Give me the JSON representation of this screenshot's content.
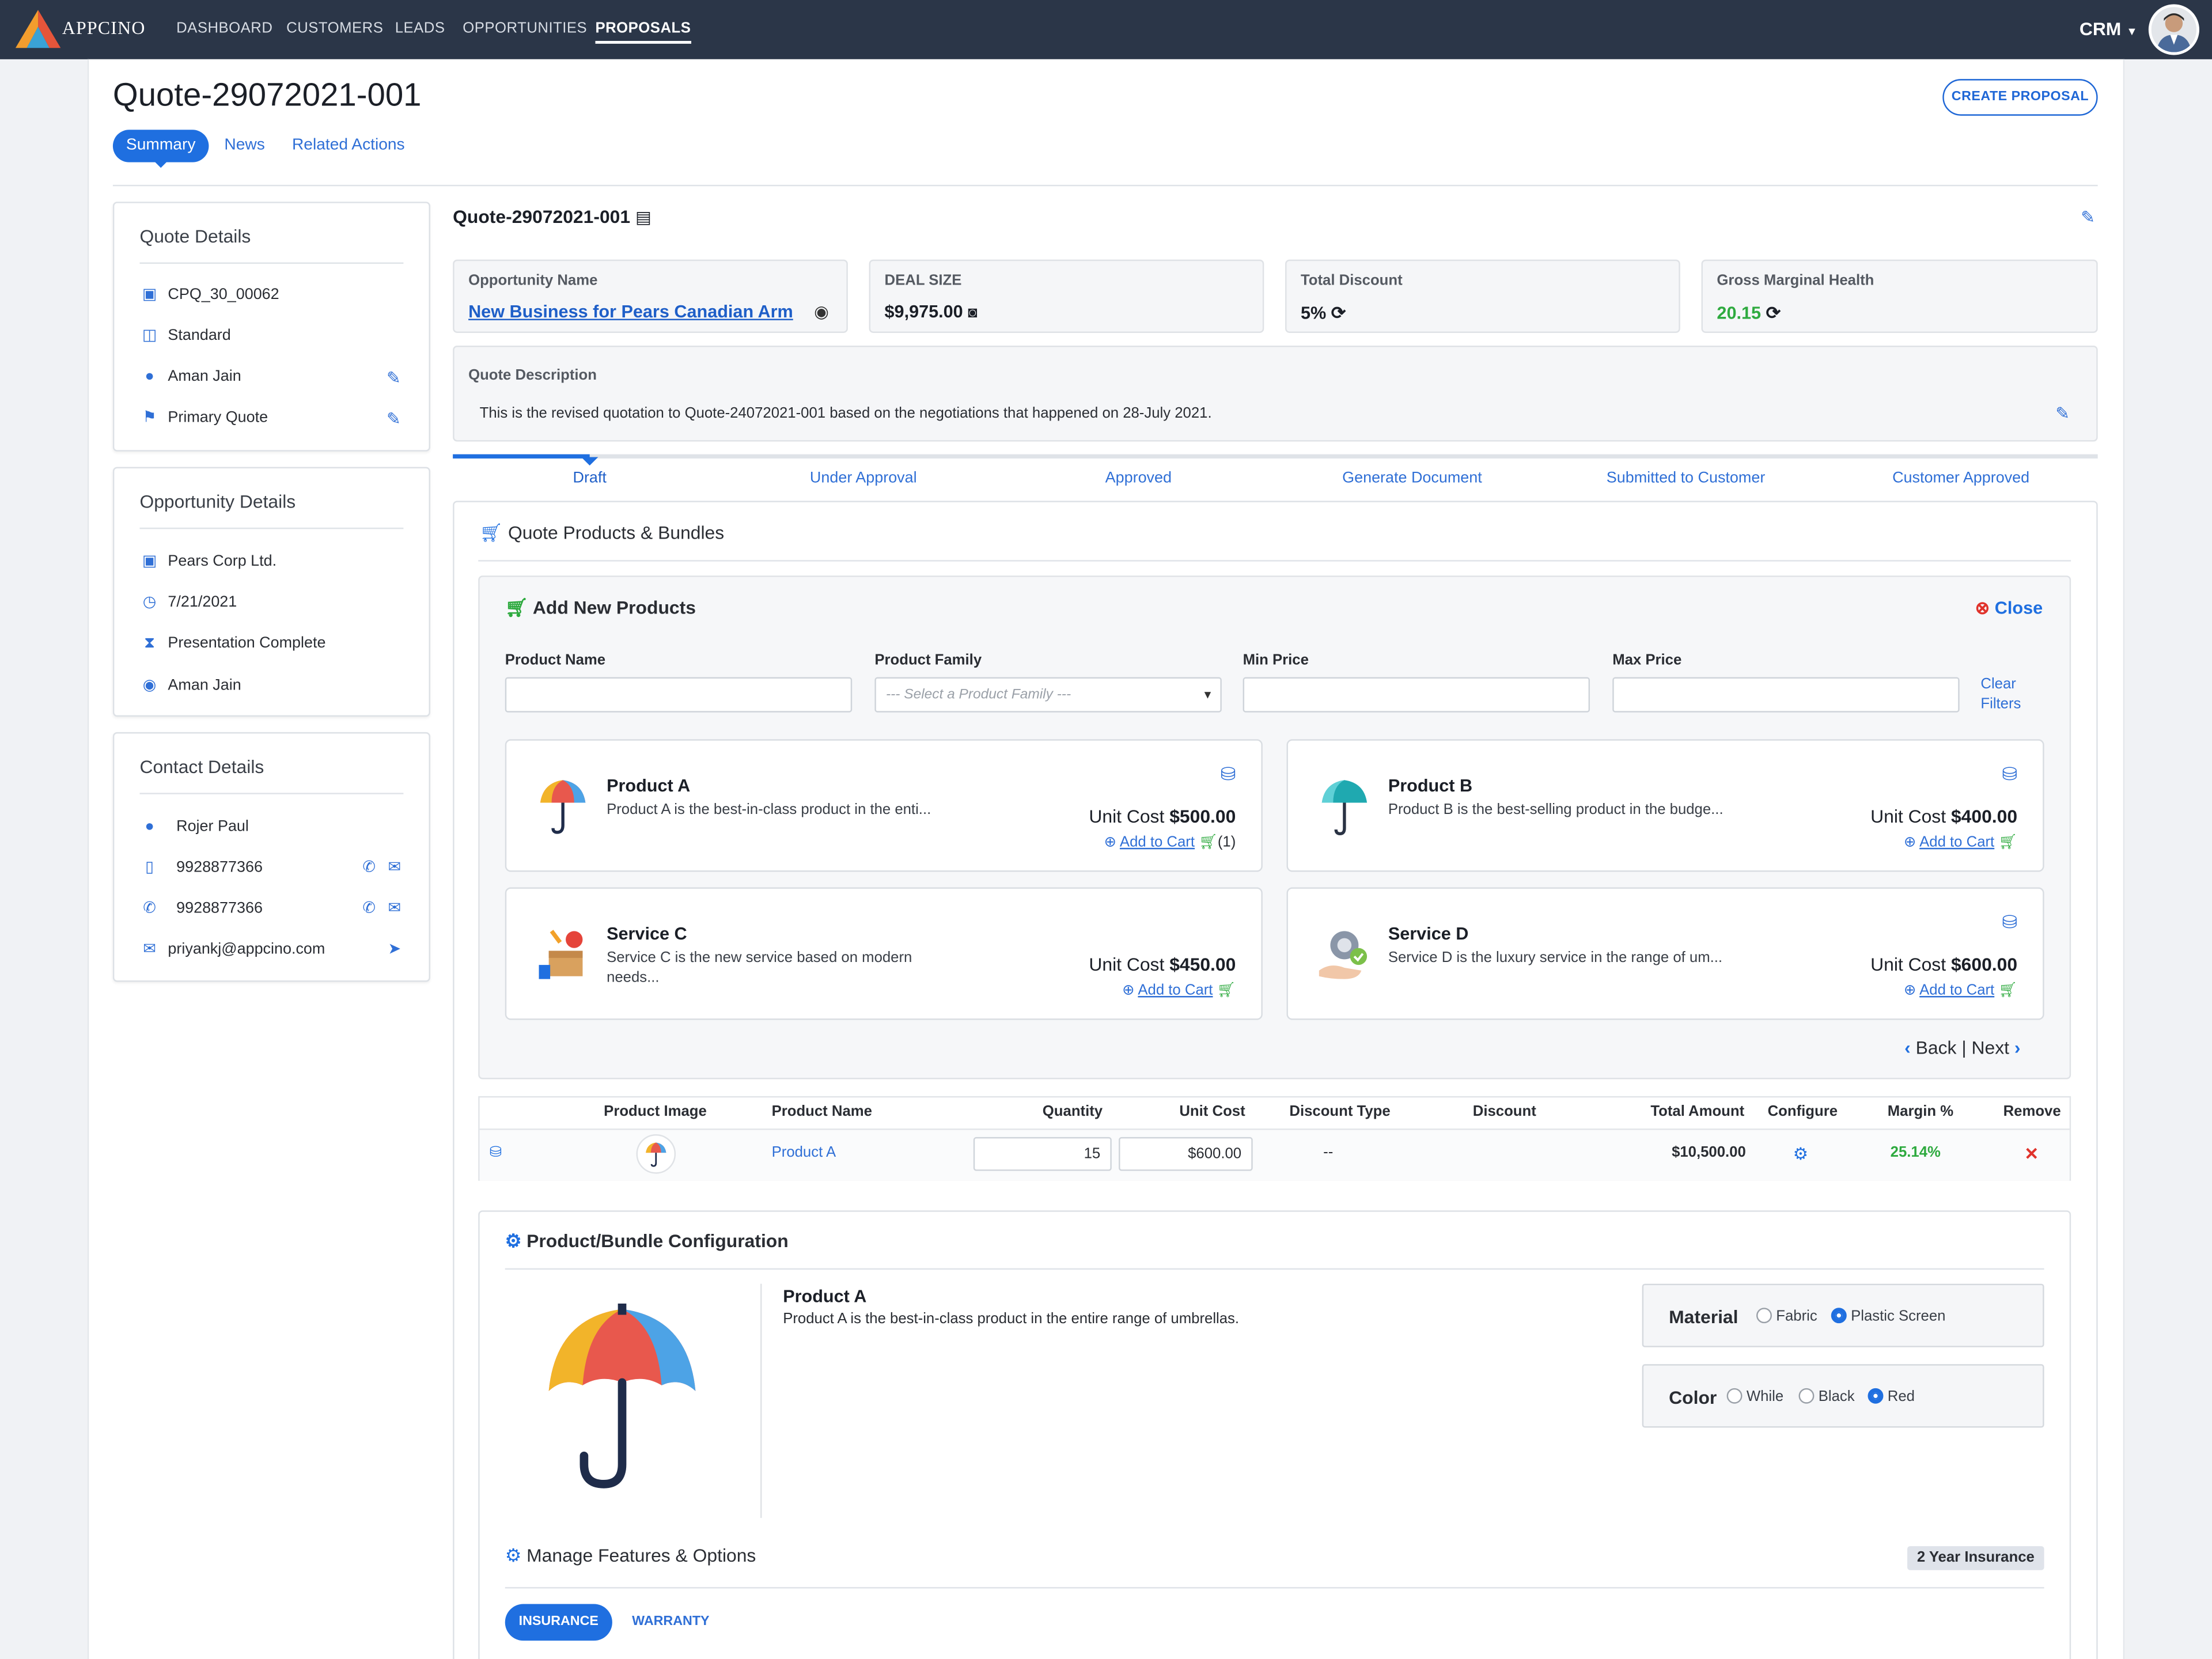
{
  "nav": {
    "brand": "APPCINO",
    "items": [
      "DASHBOARD",
      "CUSTOMERS",
      "LEADS",
      "OPPORTUNITIES",
      "PROPOSALS"
    ],
    "active": "PROPOSALS",
    "app_switcher": "CRM"
  },
  "page": {
    "title": "Quote-29072021-001",
    "create_button": "CREATE PROPOSAL",
    "tabs": [
      "Summary",
      "News",
      "Related Actions"
    ]
  },
  "quote_details": {
    "heading": "Quote Details",
    "items": [
      {
        "icon": "id-card-icon",
        "text": "CPQ_30_00062"
      },
      {
        "icon": "money-icon",
        "text": "Standard"
      },
      {
        "icon": "user-icon",
        "text": "Aman Jain"
      },
      {
        "icon": "flag-icon",
        "text": "Primary Quote"
      }
    ]
  },
  "opportunity_details": {
    "heading": "Opportunity Details",
    "items": [
      {
        "icon": "id-card-icon",
        "text": "Pears Corp Ltd."
      },
      {
        "icon": "clock-icon",
        "text": "7/21/2021"
      },
      {
        "icon": "hourglass-icon",
        "text": "Presentation Complete"
      },
      {
        "icon": "user-circle-icon",
        "text": "Aman Jain"
      }
    ]
  },
  "contact_details": {
    "heading": "Contact Details",
    "items": [
      {
        "icon": "user-icon",
        "text": "Rojer Paul"
      },
      {
        "icon": "mobile-icon",
        "text": "9928877366"
      },
      {
        "icon": "phone-icon",
        "text": "9928877366"
      },
      {
        "icon": "envelope-icon",
        "text": "priyankj@appcino.com"
      }
    ]
  },
  "quote": {
    "header": "Quote-29072021-001",
    "opportunity_label": "Opportunity Name",
    "opportunity_value": "New Business for Pears Canadian Arm",
    "deal_label": "DEAL SIZE",
    "deal_value": "$9,975.00",
    "discount_label": "Total Discount",
    "discount_value": "5%",
    "margin_label": "Gross Marginal Health",
    "margin_value": "20.15",
    "description_label": "Quote Description",
    "description": "This is the revised quotation to Quote-24072021-001 based on the negotiations that happened on 28-July 2021."
  },
  "stages": [
    "Draft",
    "Under Approval",
    "Approved",
    "Generate Document",
    "Submitted to Customer",
    "Customer Approved"
  ],
  "active_stage": "Draft",
  "products_section": {
    "heading": "Quote Products & Bundles",
    "add_heading": "Add New Products",
    "close": "Close",
    "filters": {
      "product_name": "Product Name",
      "product_family": "Product Family",
      "family_placeholder": "--- Select a Product Family ---",
      "min_price": "Min Price",
      "max_price": "Max Price",
      "clear": "Clear",
      "clear2": "Filters"
    },
    "products": [
      {
        "name": "Product A",
        "desc": "Product A is the best-in-class product in the enti...",
        "unit_label": "Unit Cost",
        "cost": "$500.00",
        "add": "Add to Cart",
        "count": "(1)"
      },
      {
        "name": "Product B",
        "desc": "Product B is the best-selling product in the budge...",
        "unit_label": "Unit Cost",
        "cost": "$400.00",
        "add": "Add to Cart",
        "count": ""
      },
      {
        "name": "Service C",
        "desc": "Service C is the new service based on modern needs...",
        "unit_label": "Unit Cost",
        "cost": "$450.00",
        "add": "Add to Cart",
        "count": ""
      },
      {
        "name": "Service D",
        "desc": "Service D is the luxury service in the range of um...",
        "unit_label": "Unit Cost",
        "cost": "$600.00",
        "add": "Add to Cart",
        "count": ""
      }
    ],
    "pager": {
      "back": "Back",
      "sep": "|",
      "next": "Next"
    }
  },
  "cart_table": {
    "headers": [
      "Product Image",
      "Product Name",
      "Quantity",
      "Unit Cost",
      "Discount Type",
      "Discount",
      "Total Amount",
      "Configure",
      "Margin %",
      "Remove"
    ],
    "rows": [
      {
        "name": "Product A",
        "quantity": "15",
        "unit_cost": "$600.00",
        "discount_type": "--",
        "discount": "",
        "total": "$10,500.00",
        "margin": "25.14%"
      }
    ]
  },
  "configuration": {
    "heading": "Product/Bundle Configuration",
    "product_name": "Product A",
    "product_desc": "Product A is the best-in-class product in the entire range of umbrellas.",
    "material_label": "Material",
    "material_options": [
      "Fabric",
      "Plastic Screen"
    ],
    "material_selected": "Plastic Screen",
    "color_label": "Color",
    "color_options": [
      "While",
      "Black",
      "Red"
    ],
    "color_selected": "Red",
    "features_heading": "Manage Features & Options",
    "badge": "2 Year Insurance",
    "tabs": [
      "INSURANCE",
      "WARRANTY"
    ]
  },
  "colors": {
    "nav": "#2b3648",
    "accent": "#1f6fe0",
    "success": "#2eaa3f",
    "danger": "#e0322b"
  }
}
